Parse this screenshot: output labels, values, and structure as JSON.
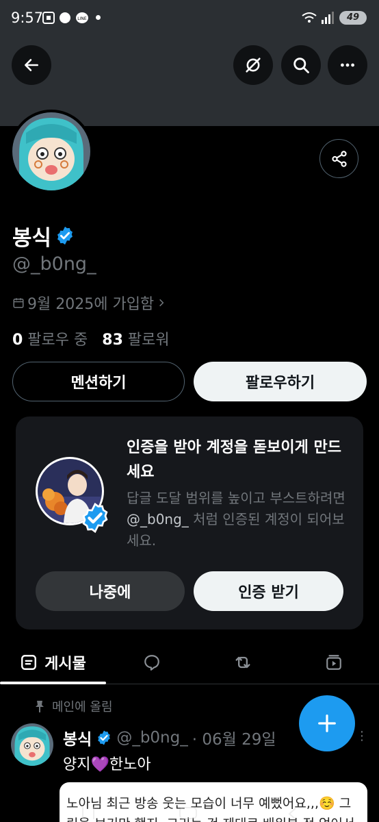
{
  "status_bar": {
    "time": "9:57",
    "battery": "49"
  },
  "header": {
    "back": "back-arrow-icon",
    "translate": "grok-icon",
    "search": "search-icon",
    "more": "more-icon"
  },
  "profile": {
    "display_name": "봉식",
    "handle": "@_b0ng_",
    "joined": "9월 2025에 가입함",
    "following_count": "0",
    "following_label": "팔로우 중",
    "followers_count": "83",
    "followers_label": "팔로워"
  },
  "actions": {
    "mention": "멘션하기",
    "follow": "팔로우하기"
  },
  "verify_card": {
    "title": "인증을 받아 계정을 돋보이게 만드세요",
    "body_pre": "답글 도달 범위를 높이고 부스트하려면 ",
    "body_handle": "@_b0ng_",
    "body_post": " 처럼 인증된 계정이 되어보세요.",
    "later": "나중에",
    "get_verified": "인증 받기"
  },
  "tabs": [
    {
      "label": "게시물",
      "icon": "posts-icon"
    },
    {
      "label": "",
      "icon": "replies-icon"
    },
    {
      "label": "",
      "icon": "reposts-icon"
    },
    {
      "label": "",
      "icon": "media-icon"
    }
  ],
  "post": {
    "pinned_label": "메인에 올림",
    "author": "봉식",
    "handle": "@_b0ng_",
    "date": "· 06월 29일",
    "text": "양지💜한노아",
    "quote_text": "노아님 최근 방송 웃는 모습이 너무 예뻤어요,,,☺️ 그림을 보기만 했지, 그리는 건 제대로 배워본 적 없어서 되"
  },
  "colors": {
    "accent": "#1d9bf0",
    "background": "#000000",
    "banner": "#2b2f33"
  }
}
